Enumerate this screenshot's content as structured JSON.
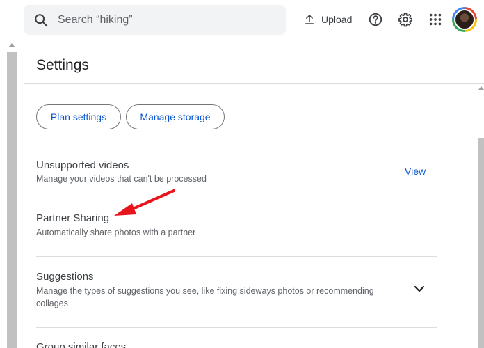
{
  "header": {
    "search_placeholder": "Search “hiking”",
    "upload_label": "Upload"
  },
  "icons": {
    "search": "search-icon",
    "upload": "upload-icon",
    "help": "help-icon",
    "settings": "gear-icon",
    "apps": "apps-grid-icon",
    "expand": "chevron-down-icon"
  },
  "settings": {
    "title": "Settings",
    "buttons": {
      "plan": "Plan settings",
      "storage": "Manage storage"
    },
    "rows": [
      {
        "title": "Unsupported videos",
        "subtitle": "Manage your videos that can't be processed",
        "action": "View"
      },
      {
        "title": "Partner Sharing",
        "subtitle": "Automatically share photos with a partner"
      },
      {
        "title": "Suggestions",
        "subtitle": "Manage the types of suggestions you see, like fixing sideways photos or recommending collages"
      },
      {
        "title": "Group similar faces"
      }
    ]
  },
  "colors": {
    "accent": "#0b57d0",
    "annotation_arrow": "#e8141b"
  }
}
